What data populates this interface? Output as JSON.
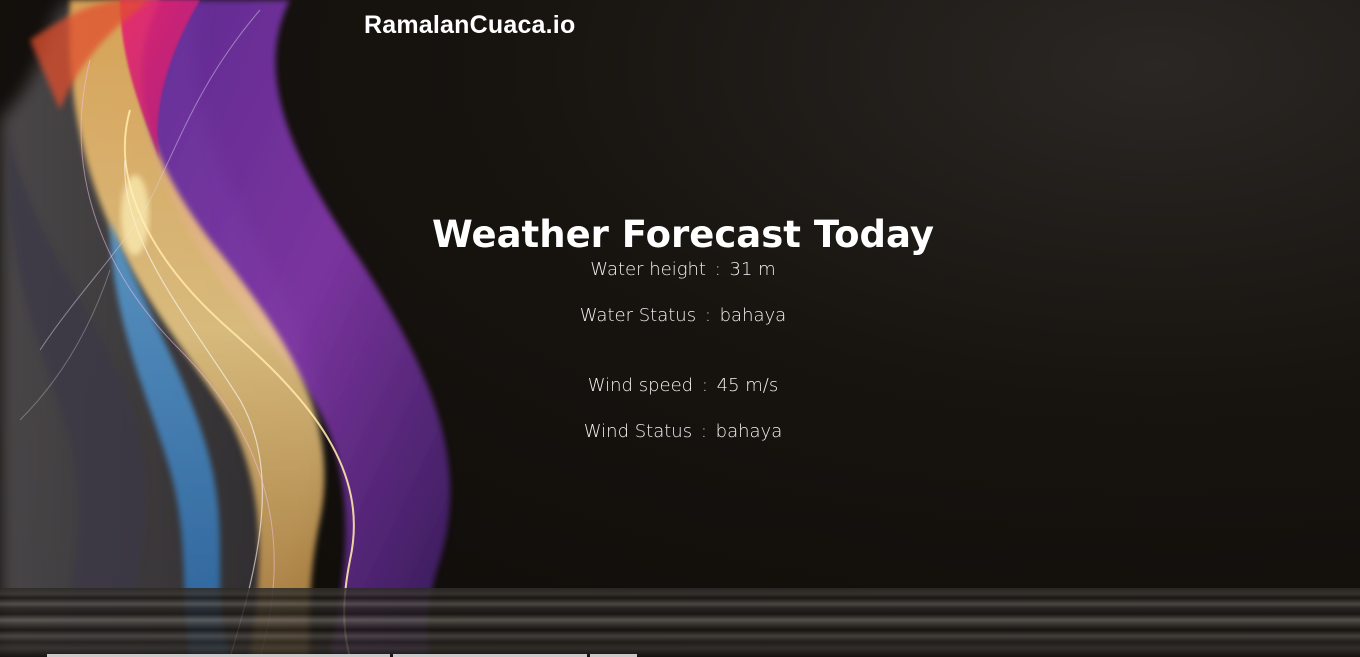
{
  "header": {
    "brand": "RamalanCuaca.io"
  },
  "main": {
    "title": "Weather Forecast Today",
    "water_height": {
      "label": "Water height",
      "value": "31 m"
    },
    "water_status": {
      "label": "Water Status",
      "value": "bahaya"
    },
    "wind_speed": {
      "label": "Wind speed",
      "value": "45 m/s"
    },
    "wind_status": {
      "label": "Wind Status",
      "value": "bahaya"
    },
    "separator": ":"
  },
  "theme": {
    "background": "#0f0c0a",
    "text": "#ffffff"
  }
}
